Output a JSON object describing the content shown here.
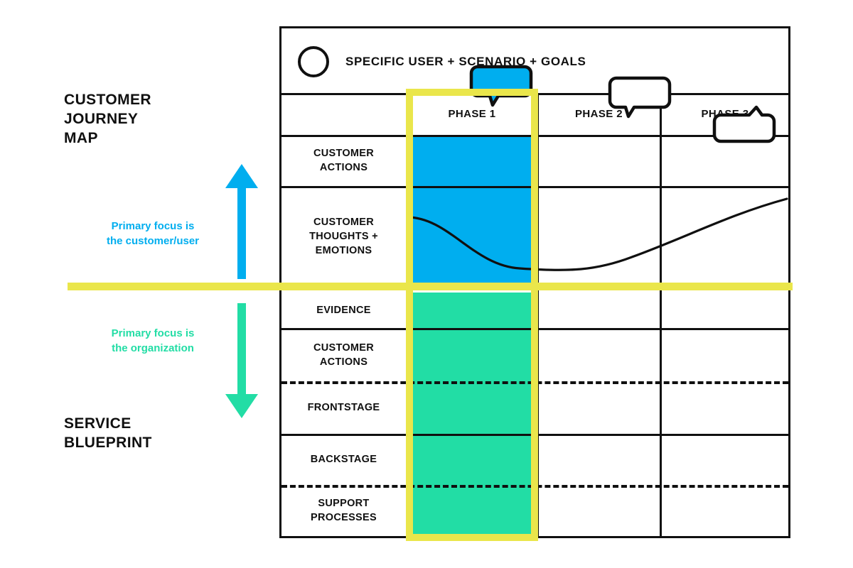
{
  "diagram": {
    "title_left_top": "CUSTOMER\nJOURNEY\nMAP",
    "title_left_bottom": "SERVICE\nBLUEPRINT",
    "note_upper": "Primary focus is\nthe customer/user",
    "note_lower": "Primary focus is\nthe organization",
    "banner": "SPECIFIC USER + SCENARIO + GOALS",
    "phases": [
      "PHASE 1",
      "PHASE 2",
      "PHASE 3"
    ],
    "rows": [
      "CUSTOMER\nACTIONS",
      "CUSTOMER\nTHOUGHTS +\nEMOTIONS",
      "EVIDENCE",
      "CUSTOMER\nACTIONS",
      "FRONTSTAGE",
      "BACKSTAGE",
      "SUPPORT\nPROCESSES"
    ],
    "colors": {
      "blue": "#00AEEF",
      "green": "#22DDA5",
      "yellow": "#EAE64B",
      "ink": "#101010",
      "paper": "#FFFFFF"
    },
    "icons": {
      "persona": "circle-icon",
      "arrow_up": "arrow-up-icon",
      "arrow_down": "arrow-down-icon",
      "emotion_curve": "emotion-curve-line",
      "bubbles": [
        "speech-bubble-icon",
        "speech-bubble-icon",
        "speech-bubble-icon"
      ]
    }
  }
}
